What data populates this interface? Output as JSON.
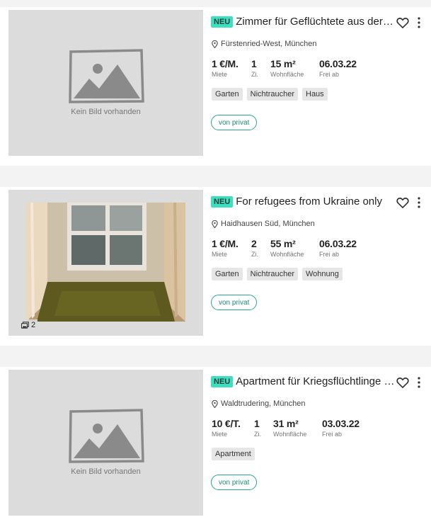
{
  "colors": {
    "badge_bg": "#3ce0c0",
    "button_border": "#2ba58f",
    "placeholder_bg": "#dcdcdc",
    "divider_bg": "#f3f3f3"
  },
  "listings": [
    {
      "badge": "NEU",
      "title": "Zimmer für Geflüchtete aus der Ukraine",
      "location": "Fürstenried-West, München",
      "price": "1 €/M.",
      "price_label": "Miete",
      "rooms": "1",
      "rooms_label": "Zi.",
      "area": "15 m²",
      "area_label": "Wohnfläche",
      "available": "06.03.22",
      "available_label": "Frei ab",
      "tags": [
        "Garten",
        "Nichtraucher",
        "Haus"
      ],
      "image_placeholder": "Kein Bild vorhanden",
      "button": "von privat"
    },
    {
      "badge": "NEU",
      "title": "For refugees from Ukraine only",
      "location": "Haidhausen Süd, München",
      "price": "1 €/M.",
      "price_label": "Miete",
      "rooms": "2",
      "rooms_label": "Zi.",
      "area": "55 m²",
      "area_label": "Wohnfläche",
      "available": "06.03.22",
      "available_label": "Frei ab",
      "tags": [
        "Garten",
        "Nichtraucher",
        "Wohnung"
      ],
      "photo_count": "2",
      "button": "von privat"
    },
    {
      "badge": "NEU",
      "title": "Apartment für Kriegsflüchtlinge aus der Ukraine",
      "location": "Waldtrudering, München",
      "price": "10 €/T.",
      "price_label": "Miete",
      "rooms": "1",
      "rooms_label": "Zi.",
      "area": "31 m²",
      "area_label": "Wohnfläche",
      "available": "03.03.22",
      "available_label": "Frei ab",
      "tags": [
        "Apartment"
      ],
      "image_placeholder": "Kein Bild vorhanden",
      "button": "von privat"
    }
  ]
}
